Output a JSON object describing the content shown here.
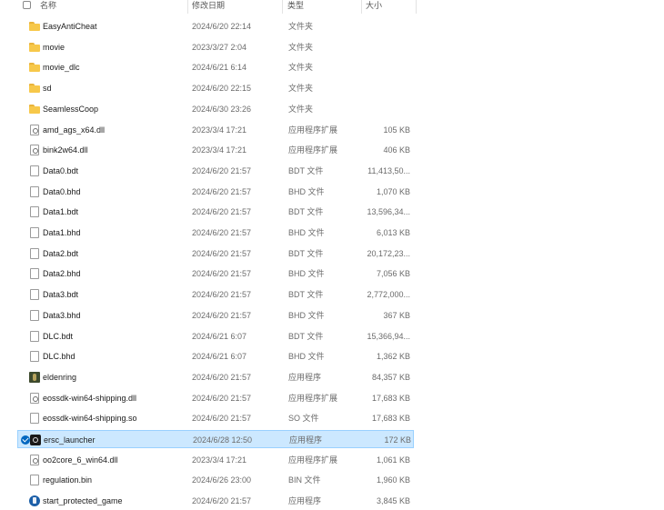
{
  "header": {
    "name_label": "名称",
    "date_label": "修改日期",
    "type_label": "类型",
    "size_label": "大小"
  },
  "files": [
    {
      "name": "EasyAntiCheat",
      "date": "2024/6/20 22:14",
      "type": "文件夹",
      "size": "",
      "icon": "folder-icon",
      "selected": false
    },
    {
      "name": "movie",
      "date": "2023/3/27 2:04",
      "type": "文件夹",
      "size": "",
      "icon": "folder-icon",
      "selected": false
    },
    {
      "name": "movie_dlc",
      "date": "2024/6/21 6:14",
      "type": "文件夹",
      "size": "",
      "icon": "folder-icon",
      "selected": false
    },
    {
      "name": "sd",
      "date": "2024/6/20 22:15",
      "type": "文件夹",
      "size": "",
      "icon": "folder-icon",
      "selected": false
    },
    {
      "name": "SeamlessCoop",
      "date": "2024/6/30 23:26",
      "type": "文件夹",
      "size": "",
      "icon": "folder-icon",
      "selected": false
    },
    {
      "name": "amd_ags_x64.dll",
      "date": "2023/3/4 17:21",
      "type": "应用程序扩展",
      "size": "105 KB",
      "icon": "dll-file-icon",
      "selected": false
    },
    {
      "name": "bink2w64.dll",
      "date": "2023/3/4 17:21",
      "type": "应用程序扩展",
      "size": "406 KB",
      "icon": "dll-file-icon",
      "selected": false
    },
    {
      "name": "Data0.bdt",
      "date": "2024/6/20 21:57",
      "type": "BDT 文件",
      "size": "11,413,50...",
      "icon": "file-icon",
      "selected": false
    },
    {
      "name": "Data0.bhd",
      "date": "2024/6/20 21:57",
      "type": "BHD 文件",
      "size": "1,070 KB",
      "icon": "file-icon",
      "selected": false
    },
    {
      "name": "Data1.bdt",
      "date": "2024/6/20 21:57",
      "type": "BDT 文件",
      "size": "13,596,34...",
      "icon": "file-icon",
      "selected": false
    },
    {
      "name": "Data1.bhd",
      "date": "2024/6/20 21:57",
      "type": "BHD 文件",
      "size": "6,013 KB",
      "icon": "file-icon",
      "selected": false
    },
    {
      "name": "Data2.bdt",
      "date": "2024/6/20 21:57",
      "type": "BDT 文件",
      "size": "20,172,23...",
      "icon": "file-icon",
      "selected": false
    },
    {
      "name": "Data2.bhd",
      "date": "2024/6/20 21:57",
      "type": "BHD 文件",
      "size": "7,056 KB",
      "icon": "file-icon",
      "selected": false
    },
    {
      "name": "Data3.bdt",
      "date": "2024/6/20 21:57",
      "type": "BDT 文件",
      "size": "2,772,000...",
      "icon": "file-icon",
      "selected": false
    },
    {
      "name": "Data3.bhd",
      "date": "2024/6/20 21:57",
      "type": "BHD 文件",
      "size": "367 KB",
      "icon": "file-icon",
      "selected": false
    },
    {
      "name": "DLC.bdt",
      "date": "2024/6/21 6:07",
      "type": "BDT 文件",
      "size": "15,366,94...",
      "icon": "file-icon",
      "selected": false
    },
    {
      "name": "DLC.bhd",
      "date": "2024/6/21 6:07",
      "type": "BHD 文件",
      "size": "1,362 KB",
      "icon": "file-icon",
      "selected": false
    },
    {
      "name": "eldenring",
      "date": "2024/6/20 21:57",
      "type": "应用程序",
      "size": "84,357 KB",
      "icon": "eldenring-app-icon",
      "selected": false
    },
    {
      "name": "eossdk-win64-shipping.dll",
      "date": "2024/6/20 21:57",
      "type": "应用程序扩展",
      "size": "17,683 KB",
      "icon": "dll-file-icon",
      "selected": false
    },
    {
      "name": "eossdk-win64-shipping.so",
      "date": "2024/6/20 21:57",
      "type": "SO 文件",
      "size": "17,683 KB",
      "icon": "file-icon",
      "selected": false
    },
    {
      "name": "ersc_launcher",
      "date": "2024/6/28 12:50",
      "type": "应用程序",
      "size": "172 KB",
      "icon": "ersc-launcher-app-icon",
      "selected": true
    },
    {
      "name": "oo2core_6_win64.dll",
      "date": "2023/3/4 17:21",
      "type": "应用程序扩展",
      "size": "1,061 KB",
      "icon": "dll-file-icon",
      "selected": false
    },
    {
      "name": "regulation.bin",
      "date": "2024/6/26 23:00",
      "type": "BIN 文件",
      "size": "1,960 KB",
      "icon": "file-icon",
      "selected": false
    },
    {
      "name": "start_protected_game",
      "date": "2024/6/20 21:57",
      "type": "应用程序",
      "size": "3,845 KB",
      "icon": "easyanticheat-app-icon",
      "selected": false
    }
  ]
}
